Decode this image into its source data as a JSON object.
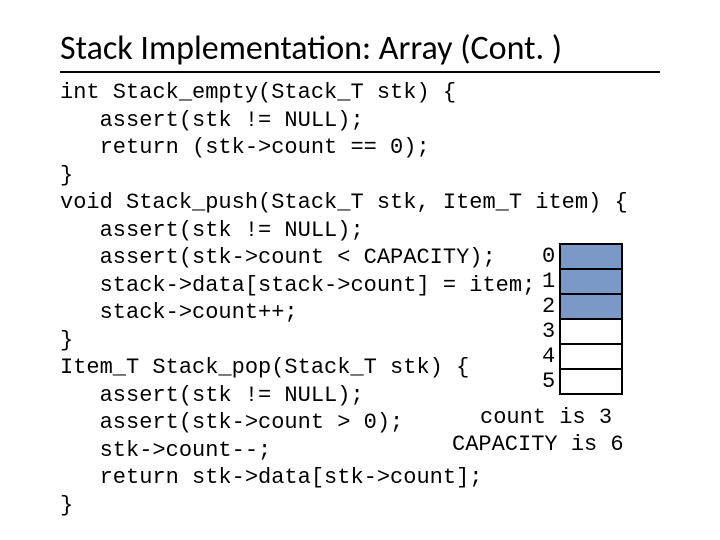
{
  "title": "Stack Implementation: Array (Cont. )",
  "code": {
    "l01": "int Stack_empty(Stack_T stk) {",
    "l02": "   assert(stk != NULL);",
    "l03": "   return (stk->count == 0);",
    "l04": "}",
    "l05": "void Stack_push(Stack_T stk, Item_T item) {",
    "l06": "   assert(stk != NULL);",
    "l07": "   assert(stk->count < CAPACITY);",
    "l08": "   stack->data[stack->count] = item;",
    "l09": "   stack->count++;",
    "l10": "}",
    "l11": "Item_T Stack_pop(Stack_T stk) {",
    "l12": "   assert(stk != NULL);",
    "l13": "   assert(stk->count > 0);",
    "l14": "   stk->count--;",
    "l15": "   return stk->data[stk->count];",
    "l16": "}"
  },
  "diagram": {
    "indices": [
      "0",
      "1",
      "2",
      "3",
      "4",
      "5"
    ],
    "filled": [
      true,
      true,
      true,
      false,
      false,
      false
    ],
    "count_label": "count is 3",
    "capacity_label": "CAPACITY is 6"
  },
  "chart_data": {
    "type": "table",
    "title": "Array-backed stack state",
    "categories": [
      "0",
      "1",
      "2",
      "3",
      "4",
      "5"
    ],
    "values_filled": [
      1,
      1,
      1,
      0,
      0,
      0
    ],
    "count": 3,
    "capacity": 6
  }
}
